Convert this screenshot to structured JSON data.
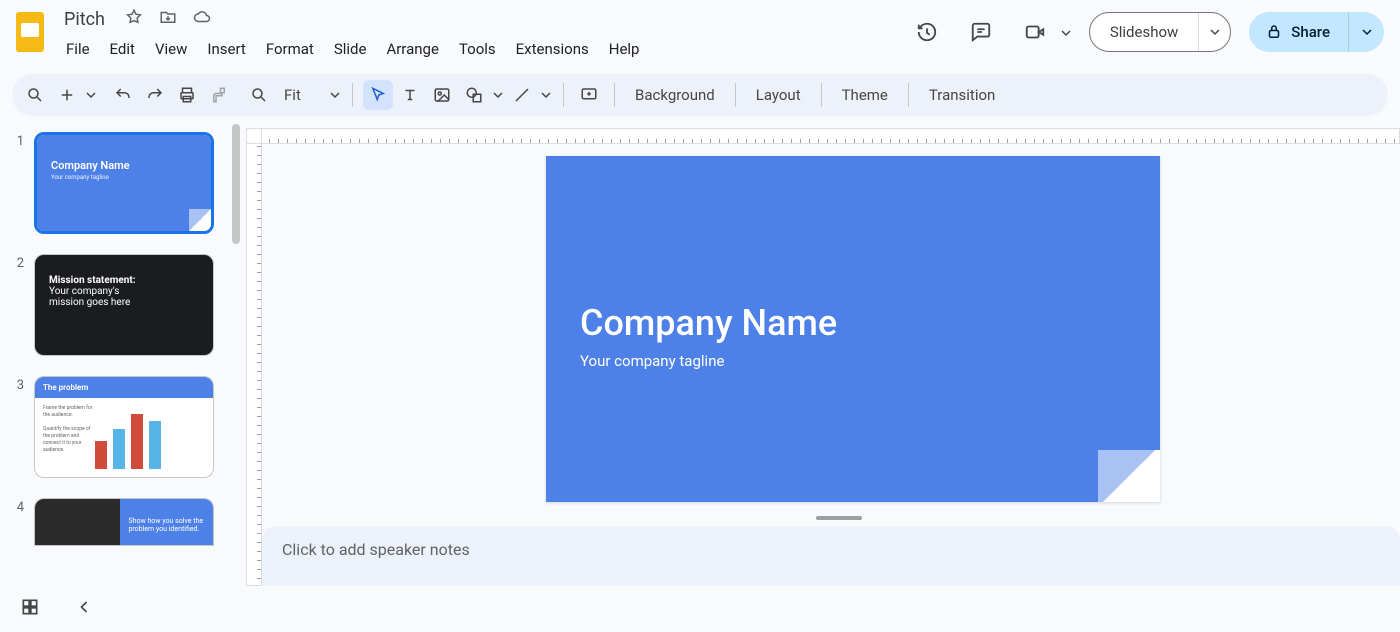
{
  "doc": {
    "title": "Pitch"
  },
  "menus": [
    "File",
    "Edit",
    "View",
    "Insert",
    "Format",
    "Slide",
    "Arrange",
    "Tools",
    "Extensions",
    "Help"
  ],
  "header": {
    "slideshow": "Slideshow",
    "share": "Share"
  },
  "toolbar": {
    "zoom": "Fit",
    "background": "Background",
    "layout": "Layout",
    "theme": "Theme",
    "transition": "Transition"
  },
  "slide": {
    "title": "Company Name",
    "subtitle": "Your company tagline"
  },
  "thumbs": [
    {
      "num": "1",
      "kind": "title",
      "title": "Company Name",
      "sub": "Your company tagline"
    },
    {
      "num": "2",
      "kind": "mission",
      "line1": "Mission statement:",
      "line2": "Your company's",
      "line3": "mission goes here"
    },
    {
      "num": "3",
      "kind": "problem",
      "title": "The problem",
      "txt1": "Frame the problem for the audience.",
      "txt2": "Quantify the scope of the problem and connect it to your audience."
    },
    {
      "num": "4",
      "kind": "solve",
      "line1": "Show how you solve the",
      "line2": "problem you identified."
    }
  ],
  "notes": {
    "placeholder": "Click to add speaker notes"
  }
}
